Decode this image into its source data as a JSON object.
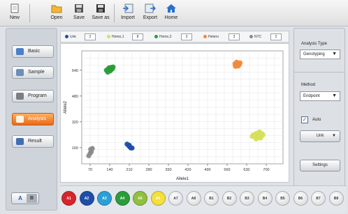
{
  "toolbar": {
    "new": "New",
    "open": "Open",
    "save": "Save",
    "save_as": "Save as",
    "import": "Import",
    "export": "Export",
    "home": "Home"
  },
  "nav": {
    "basic": "Basic",
    "sample": "Sample",
    "program": "Program",
    "analysis": "Analysis",
    "result": "Result"
  },
  "ab_toggle": {
    "a": "A",
    "b": "B"
  },
  "legend": [
    {
      "label": "Unk",
      "count": "2",
      "color": "#1f4ea8"
    },
    {
      "label": "Homo,1",
      "count": "8",
      "color": "#d6e05a"
    },
    {
      "label": "Homo,2",
      "count": "3",
      "color": "#2a9d3a"
    },
    {
      "label": "Hetero",
      "count": "3",
      "color": "#f08a3c"
    },
    {
      "label": "NTC",
      "count": "2",
      "color": "#8a8a8a"
    }
  ],
  "chart_data": {
    "type": "scatter",
    "xlabel": "Allele1",
    "ylabel": "Allele2",
    "x_ticks": [
      "70",
      "140",
      "210",
      "280",
      "350",
      "420",
      "490",
      "560",
      "630",
      "700"
    ],
    "y_ticks": [
      "160",
      "320",
      "480",
      "640"
    ],
    "xlim": [
      40,
      760
    ],
    "ylim": [
      60,
      760
    ],
    "series": [
      {
        "name": "NTC",
        "color": "#8a8a8a",
        "points": [
          [
            65,
            110
          ],
          [
            70,
            125
          ],
          [
            74,
            135
          ],
          [
            72,
            150
          ],
          [
            78,
            155
          ]
        ]
      },
      {
        "name": "Unk",
        "color": "#1f4ea8",
        "points": [
          [
            202,
            182
          ],
          [
            208,
            172
          ],
          [
            212,
            165
          ],
          [
            216,
            158
          ],
          [
            220,
            158
          ],
          [
            210,
            175
          ]
        ]
      },
      {
        "name": "Homo,2",
        "color": "#2a9d3a",
        "points": [
          [
            128,
            640
          ],
          [
            134,
            648
          ],
          [
            138,
            655
          ],
          [
            145,
            642
          ],
          [
            150,
            650
          ],
          [
            142,
            636
          ],
          [
            152,
            660
          ],
          [
            133,
            628
          ],
          [
            146,
            658
          ]
        ]
      },
      {
        "name": "Hetero",
        "color": "#f08a3c",
        "points": [
          [
            588,
            680
          ],
          [
            592,
            672
          ],
          [
            598,
            684
          ],
          [
            604,
            676
          ],
          [
            600,
            666
          ],
          [
            594,
            690
          ],
          [
            606,
            686
          ],
          [
            590,
            664
          ]
        ]
      },
      {
        "name": "Homo,1",
        "color": "#d6e05a",
        "points": [
          [
            650,
            230
          ],
          [
            658,
            238
          ],
          [
            664,
            248
          ],
          [
            672,
            252
          ],
          [
            676,
            240
          ],
          [
            682,
            232
          ],
          [
            670,
            222
          ],
          [
            660,
            226
          ],
          [
            654,
            240
          ],
          [
            676,
            258
          ],
          [
            686,
            246
          ],
          [
            664,
            214
          ],
          [
            680,
            220
          ],
          [
            688,
            238
          ]
        ]
      }
    ]
  },
  "panel": {
    "analysis_type_label": "Analysis Type",
    "analysis_type_value": "Genotyping",
    "method_label": "Method",
    "method_value": "Endpoint",
    "auto_label": "Auto",
    "auto_checked": "✓",
    "unk_button": "Unk",
    "settings_button": "Settings",
    "dropdown_arrow": "▼"
  },
  "row_a": [
    {
      "label": "A1",
      "color": "#d6262c"
    },
    {
      "label": "A2",
      "color": "#1f4ea8"
    },
    {
      "label": "A3",
      "color": "#2aa0d8"
    },
    {
      "label": "A4",
      "color": "#2a9d3a"
    },
    {
      "label": "A5",
      "color": "#8fc13f"
    },
    {
      "label": "A6",
      "color": "#f5e03c"
    },
    {
      "label": "A7"
    },
    {
      "label": "A8"
    },
    {
      "label": "B1"
    },
    {
      "label": "B2"
    },
    {
      "label": "B3"
    },
    {
      "label": "B4"
    },
    {
      "label": "B5"
    },
    {
      "label": "B6"
    },
    {
      "label": "B7"
    },
    {
      "label": "B8"
    }
  ]
}
